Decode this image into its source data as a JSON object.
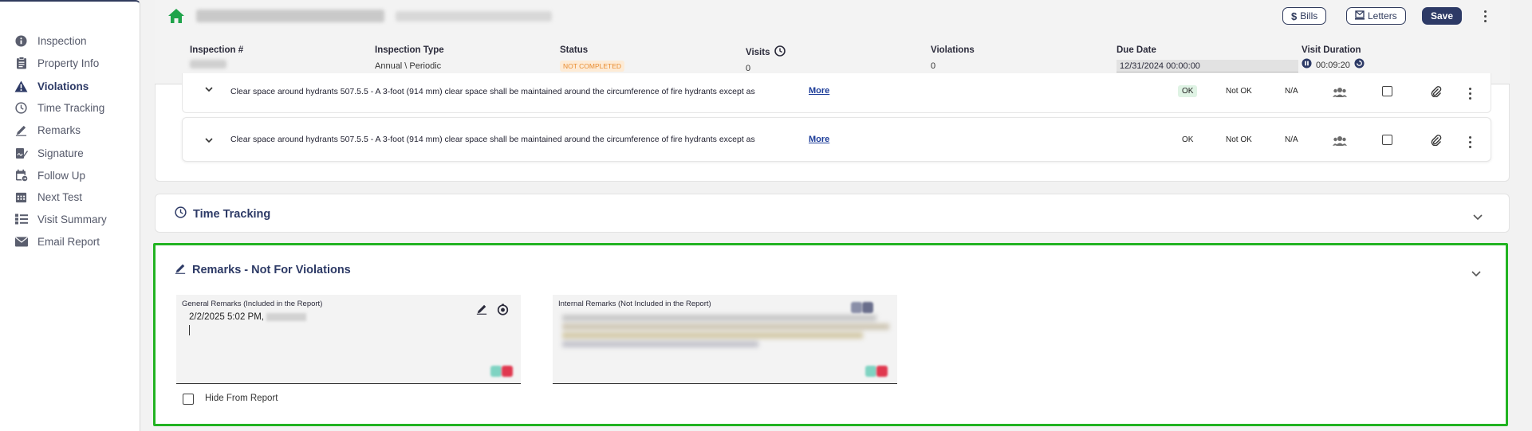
{
  "sidebar": {
    "items": [
      {
        "label": "Inspection",
        "icon": "info-circle-icon",
        "active": false
      },
      {
        "label": "Property Info",
        "icon": "clipboard-icon",
        "active": false
      },
      {
        "label": "Violations",
        "icon": "warning-triangle-icon",
        "active": true
      },
      {
        "label": "Time Tracking",
        "icon": "clock-icon",
        "active": false
      },
      {
        "label": "Remarks",
        "icon": "pencil-icon",
        "active": false
      },
      {
        "label": "Signature",
        "icon": "signature-icon",
        "active": false
      },
      {
        "label": "Follow Up",
        "icon": "calendar-followup-icon",
        "active": false
      },
      {
        "label": "Next Test",
        "icon": "calendar-grid-icon",
        "active": false
      },
      {
        "label": "Visit Summary",
        "icon": "list-icon",
        "active": false
      },
      {
        "label": "Email Report",
        "icon": "envelope-icon",
        "active": false
      }
    ]
  },
  "header": {
    "buttons": {
      "bills": "Bills",
      "letters": "Letters",
      "save": "Save"
    },
    "info": {
      "inspection_label": "Inspection #",
      "type_label": "Inspection Type",
      "type_value": "Annual \\ Periodic",
      "status_label": "Status",
      "status_value": "NOT COMPLETED",
      "visits_label": "Visits",
      "visits_value": "0",
      "violations_label": "Violations",
      "violations_value": "0",
      "due_label": "Due Date",
      "due_value": "12/31/2024 00:00:00",
      "duration_label": "Visit Duration",
      "duration_value": "00:09:20"
    },
    "colors": {
      "accent": "#2d3a66",
      "home": "#1fa34a",
      "status": "#e88b2d"
    }
  },
  "violations": {
    "rows": [
      {
        "text": "Clear space around hydrants 507.5.5 - A 3-foot (914 mm) clear space shall be maintained around the circumference of fire hydrants except as",
        "more": "More",
        "ok": "OK",
        "not_ok": "Not OK",
        "na": "N/A",
        "ok_selected": true
      },
      {
        "text": "Clear space around hydrants 507.5.5 - A 3-foot (914 mm) clear space shall be maintained around the circumference of fire hydrants except as",
        "more": "More",
        "ok": "OK",
        "not_ok": "Not OK",
        "na": "N/A",
        "ok_selected": false
      }
    ]
  },
  "time_tracking": {
    "title": "Time Tracking"
  },
  "remarks": {
    "title": "Remarks - Not For Violations",
    "general_label": "General Remarks (Included in the Report)",
    "general_text": "2/2/2025 5:02 PM,",
    "internal_label": "Internal Remarks (Not Included in the Report)",
    "hide_label": "Hide From Report",
    "highlight_color": "#22b322"
  }
}
